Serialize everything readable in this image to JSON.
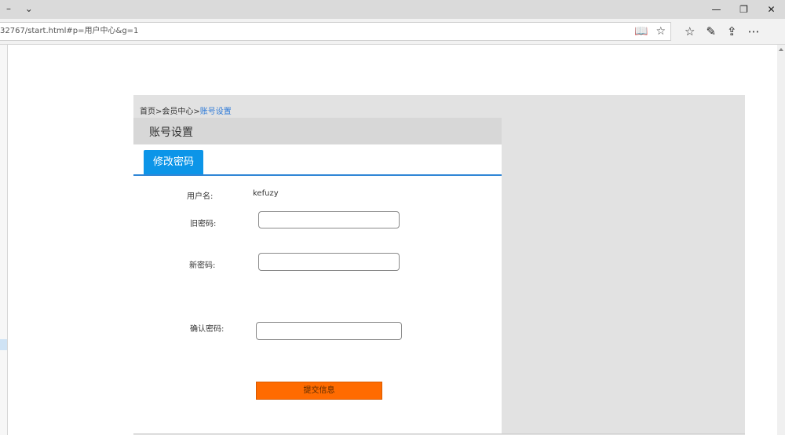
{
  "browser": {
    "tab_controls": [
      "–",
      "⌄"
    ],
    "window_controls": {
      "minimize": "—",
      "restore": "❐",
      "close": "✕"
    },
    "address": "32767/start.html#p=用户中心&g=1",
    "reading_view_icon": "book-icon",
    "favorite_icon": "star-icon",
    "toolbar_icons": [
      "favorites-list-icon",
      "pen-icon",
      "share-icon",
      "more-icon"
    ]
  },
  "breadcrumb": {
    "home": "首页",
    "sep1": ">",
    "member": "会员中心",
    "sep2": ">",
    "current": "账号设置"
  },
  "page": {
    "section_title": "账号设置",
    "tab_label": "修改密码"
  },
  "form": {
    "username_label": "用户名:",
    "username_value": "kefuzy",
    "old_password_label": "旧密码:",
    "new_password_label": "新密码:",
    "confirm_password_label": "确认密码:",
    "submit_label": "提交信息"
  },
  "colors": {
    "accent": "#0c95e8",
    "submit": "#ff6b00",
    "breadcrumb_current": "#2f7bd8"
  }
}
